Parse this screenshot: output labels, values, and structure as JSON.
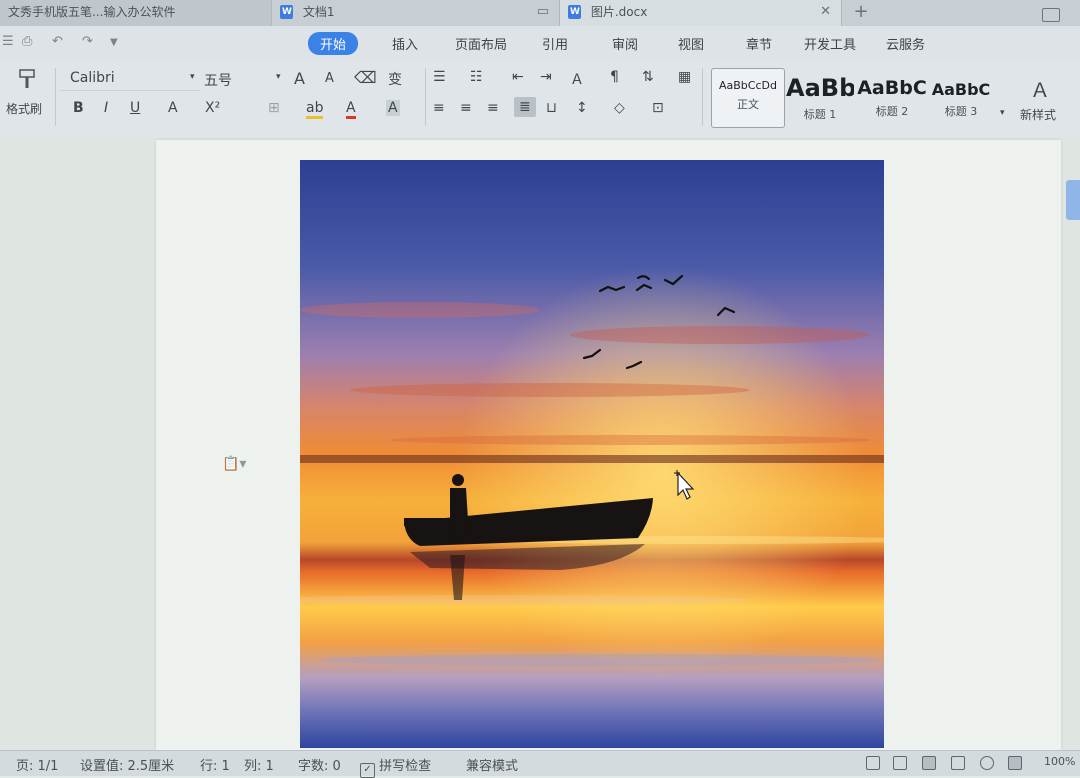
{
  "tabs": [
    {
      "title": "文秀手机版五笔...输入办公软件",
      "active": false
    },
    {
      "title": "文档1",
      "active": false
    },
    {
      "title": "图片.docx",
      "active": true
    }
  ],
  "new_tab_label": "+",
  "menu": [
    "开始",
    "插入",
    "页面布局",
    "引用",
    "审阅",
    "视图",
    "章节",
    "开发工具",
    "云服务"
  ],
  "ribbon": {
    "format_painter_label": "格式刷",
    "font_name": "Calibri",
    "font_size": "五号",
    "bold": "B",
    "italic": "I",
    "underline": "U",
    "strike_label": "A",
    "sup_label": "X²",
    "increase_font": "A",
    "decrease_font": "A",
    "pinyin_label": "变",
    "font_color": "A",
    "char_shading": "A",
    "styles": [
      {
        "sample": "AaBbCcDd",
        "label": "正文"
      },
      {
        "sample": "AaBb",
        "label": "标题 1"
      },
      {
        "sample": "AaBbC",
        "label": "标题 2"
      },
      {
        "sample": "AaBbC",
        "label": "标题 3"
      }
    ],
    "new_style_label": "新样式"
  },
  "statusbar": {
    "page": "页: 1/1",
    "position": "设置值: 2.5厘米",
    "line": "行: 1",
    "column": "列: 1",
    "word_count": "字数: 0",
    "spell_check": "拼写检查",
    "compat_mode": "兼容模式",
    "zoom": "100%"
  },
  "colors": {
    "accent": "#3a82e6",
    "sky_top": "#2f4a9e",
    "sunset_orange": "#f08a2a",
    "horizon": "#ffd24a",
    "water_bottom": "#2a46a0"
  }
}
